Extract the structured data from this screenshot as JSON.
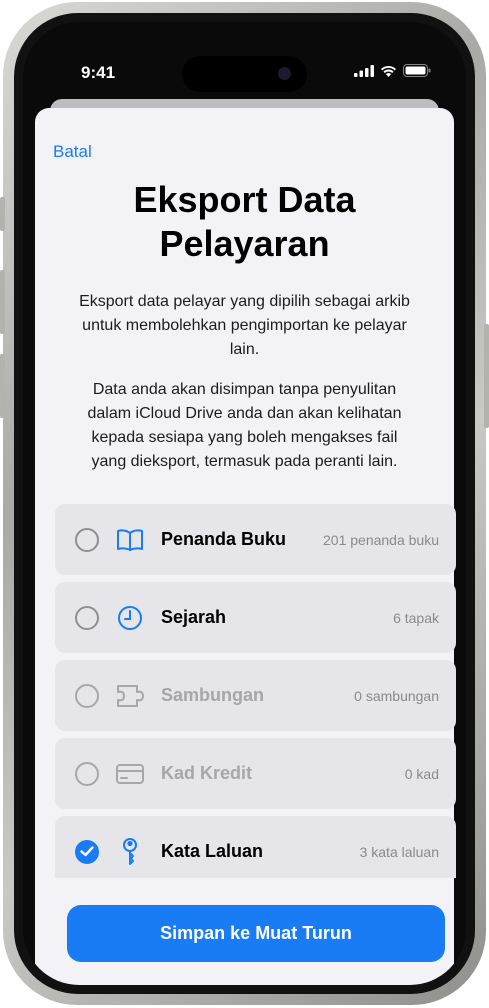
{
  "status_bar": {
    "time": "9:41"
  },
  "sheet": {
    "cancel_label": "Batal",
    "title": "Eksport Data Pelayaran",
    "description_1": "Eksport data pelayar yang dipilih sebagai arkib untuk membolehkan pengimportan ke pelayar lain.",
    "description_2": "Data anda akan disimpan tanpa penyulitan dalam iCloud Drive anda dan akan kelihatan kepada sesiapa yang boleh mengakses fail yang dieksport, termasuk pada peranti lain."
  },
  "items": [
    {
      "label": "Penanda Buku",
      "count": "201 penanda buku",
      "icon": "book-icon",
      "checked": false,
      "enabled": true
    },
    {
      "label": "Sejarah",
      "count": "6 tapak",
      "icon": "clock-icon",
      "checked": false,
      "enabled": true
    },
    {
      "label": "Sambungan",
      "count": "0 sambungan",
      "icon": "extension-icon",
      "checked": false,
      "enabled": false
    },
    {
      "label": "Kad Kredit",
      "count": "0 kad",
      "icon": "credit-card-icon",
      "checked": false,
      "enabled": false
    },
    {
      "label": "Kata Laluan",
      "count": "3 kata laluan",
      "icon": "key-icon",
      "checked": true,
      "enabled": true
    }
  ],
  "save_button_label": "Simpan ke Muat Turun",
  "colors": {
    "accent": "#1a7cf5",
    "row_bg": "#e5e5ea",
    "sheet_bg": "#f2f2f7",
    "disabled_text": "#a6a6ab"
  }
}
